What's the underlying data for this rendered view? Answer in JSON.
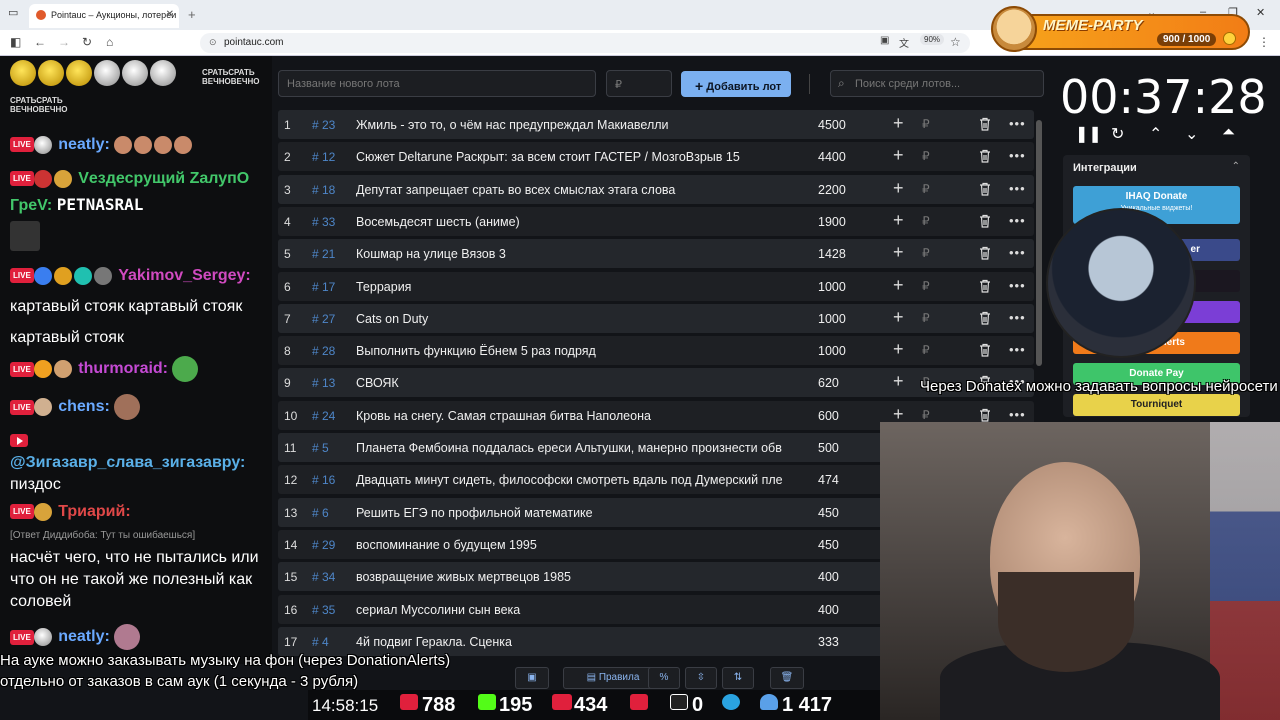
{
  "browser": {
    "tab_title": "Pointauc – Аукционы, лотереи",
    "url": "pointauc.com",
    "zoom": "90%"
  },
  "meme_party": {
    "title": "MEME-PARTY",
    "progress": "900 / 1000"
  },
  "chat": {
    "sticker_text_1": "СРАТЬСРАТЬ ВЕЧНОВЕЧНО",
    "sticker_text_2": "СРАТЬСРАТЬ ВЕЧНОВЕЧНО",
    "messages": [
      {
        "nick": "neatly:",
        "color": "#6aa9ff",
        "text": ""
      },
      {
        "nick": "Vездесрущий ZалупO",
        "color": "#42c76a",
        "text": ""
      },
      {
        "nick": "ГреV:",
        "color": "#42c76a",
        "text": "PETNASRAL"
      },
      {
        "nick": "Yakimov_Sergey:",
        "color": "#d04ac0",
        "text": "картавый стояк картавый стояк картавый стояк"
      },
      {
        "nick": "thurmoraid:",
        "color": "#c54ad4",
        "text": ""
      },
      {
        "nick": "chens:",
        "color": "#6aa9ff",
        "text": ""
      },
      {
        "nick": "@Зигазавр_слава_зигазавру:",
        "color": "#5ab0e8",
        "text": "пиздос"
      },
      {
        "nick": "Триарий:",
        "color": "#e04848",
        "reply": "[Ответ Диддибоба: Тут ты ошибаешься]",
        "text": "насчёт чего, что не пытались или что он не такой же полезный как соловей"
      },
      {
        "nick": "neatly:",
        "color": "#6aa9ff",
        "text": ""
      }
    ]
  },
  "auction": {
    "new_lot_placeholder": "Название нового лота",
    "amount_placeholder": "₽",
    "add_button": "Добавить лот",
    "search_placeholder": "Поиск среди лотов...",
    "currency": "₽",
    "lots": [
      {
        "n": "1",
        "id": "# 23",
        "name": "Жмиль - это то, о чём нас предупреждал Макиавелли",
        "amount": "4500"
      },
      {
        "n": "2",
        "id": "# 12",
        "name": "Сюжет Deltarune Раскрыт: за всем стоит ГАСТЕР / МозгоВзрыв 15",
        "amount": "4400"
      },
      {
        "n": "3",
        "id": "# 18",
        "name": "Депутат запрещает срать во всех смыслах этага слова",
        "amount": "2200"
      },
      {
        "n": "4",
        "id": "# 33",
        "name": "Восемьдесят шесть (аниме)",
        "amount": "1900"
      },
      {
        "n": "5",
        "id": "# 21",
        "name": "Кошмар на улице Вязов 3",
        "amount": "1428"
      },
      {
        "n": "6",
        "id": "# 17",
        "name": "Террария",
        "amount": "1000"
      },
      {
        "n": "7",
        "id": "# 27",
        "name": "Cats on Duty",
        "amount": "1000"
      },
      {
        "n": "8",
        "id": "# 28",
        "name": "Выполнить функцию Ёбнем 5 раз подряд",
        "amount": "1000"
      },
      {
        "n": "9",
        "id": "# 13",
        "name": "СВОЯК",
        "amount": "620"
      },
      {
        "n": "10",
        "id": "# 24",
        "name": "Кровь на снегу. Самая страшная битва Наполеона",
        "amount": "600"
      },
      {
        "n": "11",
        "id": "# 5",
        "name": "Планета Фембоина поддалась ереси Альтушки, манерно произнести обв",
        "amount": "500"
      },
      {
        "n": "12",
        "id": "# 16",
        "name": "Двадцать минут сидеть, философски смотреть вдаль под Думерский пле",
        "amount": "474"
      },
      {
        "n": "13",
        "id": "# 6",
        "name": "Решить ЕГЭ по профильной математике",
        "amount": "450"
      },
      {
        "n": "14",
        "id": "# 29",
        "name": "воспоминание о будущем 1995",
        "amount": "450"
      },
      {
        "n": "15",
        "id": "# 34",
        "name": "возвращение живых мертвецов 1985",
        "amount": "400"
      },
      {
        "n": "16",
        "id": "# 35",
        "name": "сериал Муссолини сын века",
        "amount": "400"
      },
      {
        "n": "17",
        "id": "# 4",
        "name": "4й подвиг Геракла. Сценка",
        "amount": "333"
      }
    ],
    "rules_button": "Правила"
  },
  "timer": {
    "value": "00:37:28"
  },
  "integrations": {
    "title": "Интеграции",
    "buttons": [
      {
        "label": "IHAQ Donate",
        "sub": "Уникальные виджеты!",
        "color": "#3ea0d6"
      },
      {
        "label": "er",
        "color": "#3a4a8a"
      },
      {
        "label": "",
        "color": "#1b1720"
      },
      {
        "label": "",
        "color": "#7b3ed6"
      },
      {
        "label": "Alerts",
        "color": "#f07a1a"
      },
      {
        "label": "Donate Pay",
        "color": "#3ec56a"
      },
      {
        "label": "Tourniquet",
        "color": "#e8d24a"
      }
    ]
  },
  "overlay": {
    "donatex_note": "Через Donatex можно задавать вопросы нейросети",
    "music_note_1": "На ауке можно заказывать музыку на фон (через DonationAlerts)",
    "music_note_2": "отдельно от заказов в сам аук (1 секунда - 3 рубля)"
  },
  "stream_stats": {
    "clock": "14:58:15",
    "youtube": "788",
    "kick": "195",
    "vk": "434",
    "rutube": "0",
    "total": "1 417"
  }
}
